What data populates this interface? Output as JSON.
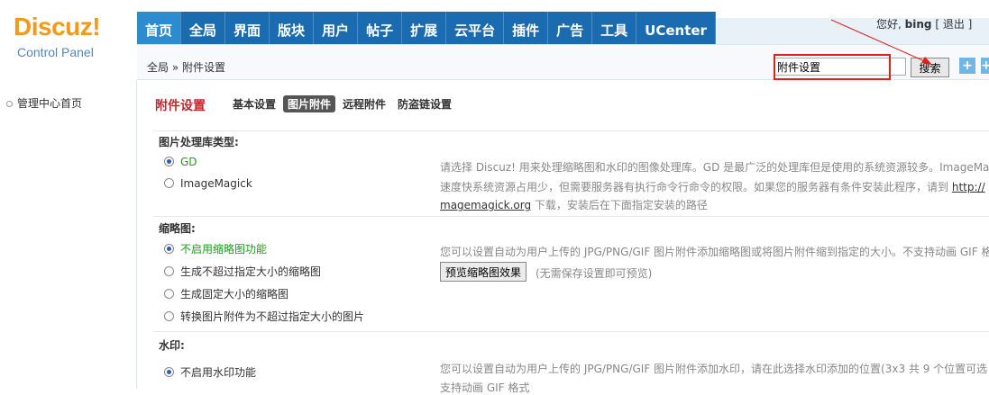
{
  "logo": {
    "brand": "Discuz!",
    "sub": "Control Panel"
  },
  "nav": {
    "tabs": [
      "首页",
      "全局",
      "界面",
      "版块",
      "用户",
      "帖子",
      "扩展",
      "云平台",
      "插件",
      "广告",
      "工具",
      "UCenter"
    ]
  },
  "user": {
    "greeting": "您好,",
    "name": "bing",
    "logout": "[ 退出 ]"
  },
  "breadcrumb": "全局 » 附件设置",
  "search": {
    "value": "附件设置",
    "button": "搜索"
  },
  "icons": {
    "plus": "+",
    "other": "+"
  },
  "sidebar": {
    "items": [
      "管理中心首页"
    ]
  },
  "main": {
    "title": "附件设置",
    "subtabs": [
      "基本设置",
      "图片附件",
      "远程附件",
      "防盗链设置"
    ],
    "sections": {
      "lib": {
        "title": "图片处理库类型:",
        "options": [
          "GD",
          "ImageMagick"
        ],
        "desc1": "请选择 Discuz! 用来处理缩略图和水印的图像处理库。GD 是最广泛的处理库但是使用的系统资源较多。ImageMa",
        "desc2": "速度快系统资源占用少，但需要服务器有执行命令行命令的权限。如果您的服务器有条件安装此程序，请到",
        "link1": "http://",
        "link2": "magemagick.org",
        "desc3": "下载，安装后在下面指定安装的路径"
      },
      "thumb": {
        "title": "缩略图:",
        "options": [
          "不启用缩略图功能",
          "生成不超过指定大小的缩略图",
          "生成固定大小的缩略图",
          "转换图片附件为不超过指定大小的图片"
        ],
        "desc": "您可以设置自动为用户上传的 JPG/PNG/GIF 图片附件添加缩略图或将图片附件缩到指定的大小。不支持动画 GIF 格",
        "preview_btn": "预览缩略图效果",
        "preview_note": "(无需保存设置即可预览)"
      },
      "watermark": {
        "title": "水印:",
        "options": [
          "不启用水印功能"
        ],
        "desc1": "您可以设置自动为用户上传的 JPG/PNG/GIF 图片附件添加水印，请在此选择水印添加的位置(3x3 共 9 个位置可选",
        "desc2": "支持动画 GIF 格式"
      }
    }
  },
  "colors": {
    "accent": "#1b6bb0",
    "title_red": "#c0282d",
    "highlight_red": "#e0201a",
    "logo_orange": "#f2991c"
  }
}
